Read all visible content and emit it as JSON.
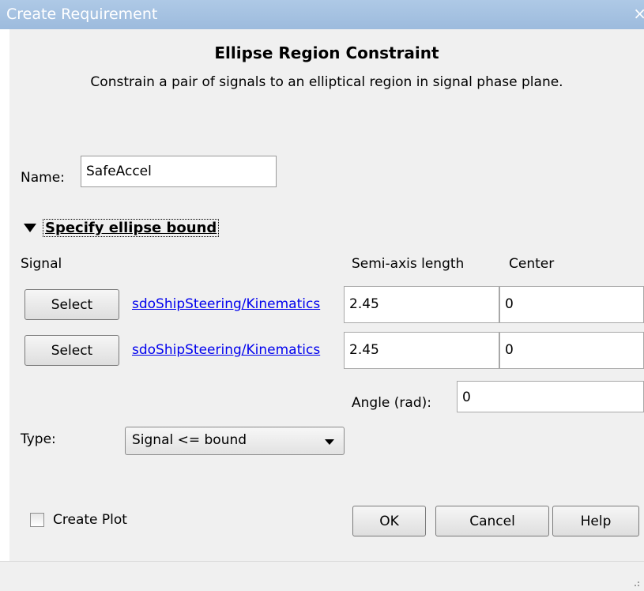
{
  "window": {
    "title": "Create Requirement",
    "close_glyph": "×"
  },
  "dialog": {
    "heading": "Ellipse Region Constraint",
    "description": "Constrain a pair of signals to an elliptical region in signal phase plane."
  },
  "name": {
    "label": "Name:",
    "value": "SafeAccel"
  },
  "section": {
    "toggle_label": "Specify ellipse bound",
    "expanded": true
  },
  "columns": {
    "signal": "Signal",
    "semi_axis": "Semi-axis length",
    "center": "Center"
  },
  "signals": [
    {
      "select_label": "Select",
      "path": "sdoShipSteering/Kinematics",
      "semi_axis": "2.45",
      "center": "0"
    },
    {
      "select_label": "Select",
      "path": "sdoShipSteering/Kinematics",
      "semi_axis": "2.45",
      "center": "0"
    }
  ],
  "angle": {
    "label": "Angle (rad):",
    "value": "0"
  },
  "type": {
    "label": "Type:",
    "selected": "Signal <= bound"
  },
  "create_plot": {
    "label": "Create Plot",
    "checked": false
  },
  "buttons": {
    "ok": "OK",
    "cancel": "Cancel",
    "help": "Help"
  },
  "colors": {
    "titlebar": "#aec9e6",
    "dialog_bg": "#f0f0f0",
    "link": "#0000ee"
  }
}
